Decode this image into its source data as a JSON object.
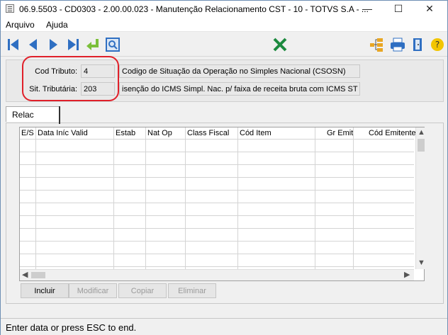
{
  "window": {
    "title": "06.9.5503 - CD0303 - 2.00.00.023 - Manutenção Relacionamento CST - 10 - TOTVS S.A - ...",
    "min": "—",
    "max": "☐",
    "close": "✕"
  },
  "menu": [
    "Arquivo",
    "Ajuda"
  ],
  "toolbar": {
    "icons": [
      "first-record-icon",
      "previous-record-icon",
      "next-record-icon",
      "last-record-icon",
      "go-to-icon",
      "search-icon",
      "excel-icon",
      "tree-view-icon",
      "print-icon",
      "exit-icon",
      "help-icon"
    ],
    "colors": {
      "nav": "#2f6fc2",
      "goto": "#7bbf3a",
      "excel": "#1d8a3f",
      "help": "#f2c500"
    }
  },
  "header": {
    "cod_tributo_label": "Cod Tributo:",
    "cod_tributo_value": "4",
    "cod_tributo_desc": "Codigo de Situação da Operação no Simples Nacional (CSOSN)",
    "sit_tributaria_label": "Sit. Tributária:",
    "sit_tributaria_value": "203",
    "sit_tributaria_desc": "isenção do ICMS Simpl. Nac. p/ faixa de receita bruta com ICMS ST"
  },
  "tab": {
    "label": "Relac"
  },
  "grid": {
    "columns": [
      "E/S",
      "Data Iníc Valid",
      "Estab",
      "Nat Op",
      "Class Fiscal",
      "Cód Item",
      "Gr Emit",
      "Cód Emitente"
    ],
    "rows": []
  },
  "buttons": {
    "incluir": "Incluir",
    "modificar": "Modificar",
    "copiar": "Copiar",
    "eliminar": "Eliminar"
  },
  "status": {
    "text": "Enter data or press ESC to end."
  },
  "colors": {
    "highlight_ring": "#e0202a"
  }
}
